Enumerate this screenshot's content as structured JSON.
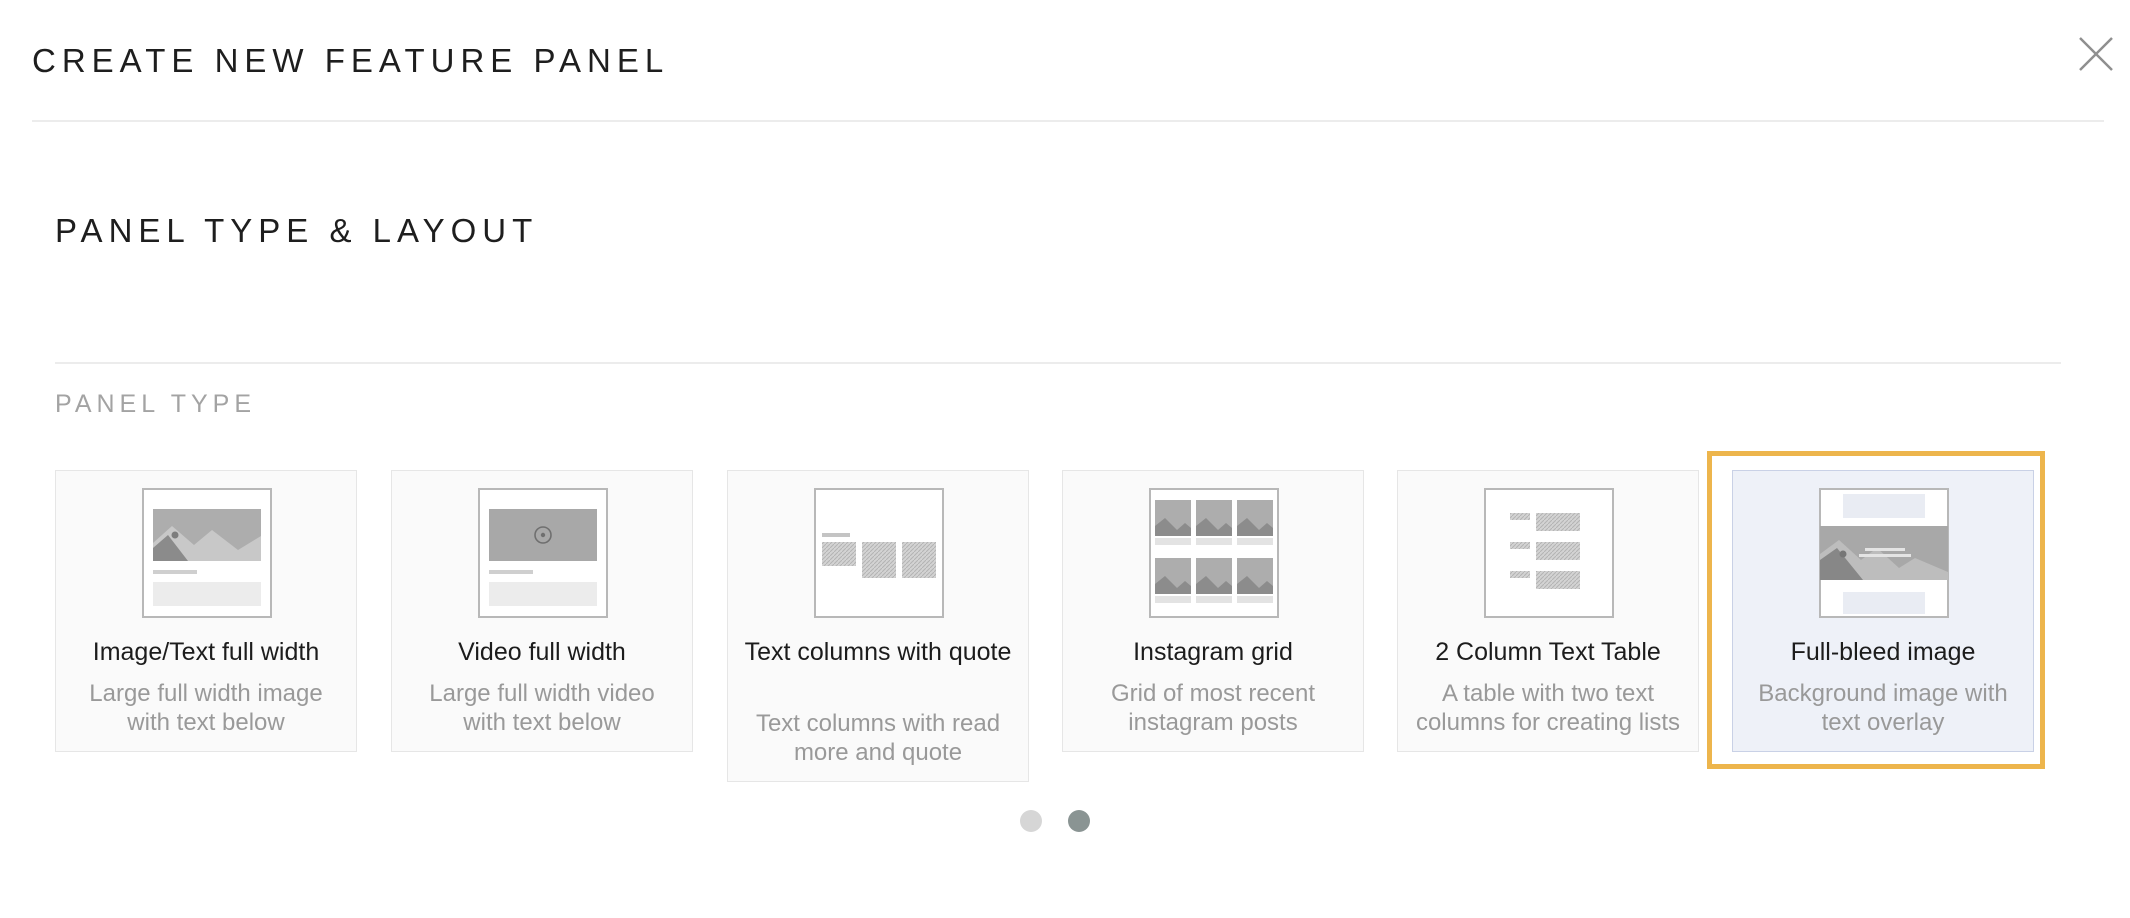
{
  "header": {
    "title": "CREATE NEW FEATURE PANEL"
  },
  "section": {
    "title": "PANEL TYPE & LAYOUT",
    "subheading": "PANEL TYPE"
  },
  "panel_types": [
    {
      "title": "Image/Text full width",
      "description": "Large full width image with text below",
      "icon": "image-text-layout-icon",
      "selected": false
    },
    {
      "title": "Video full width",
      "description": "Large full width video with text below",
      "icon": "video-layout-icon",
      "selected": false
    },
    {
      "title": "Text columns with quote",
      "description": "Text columns with read more and quote",
      "icon": "text-columns-layout-icon",
      "selected": false
    },
    {
      "title": "Instagram grid",
      "description": "Grid of most recent instagram posts",
      "icon": "instagram-grid-layout-icon",
      "selected": false
    },
    {
      "title": "2 Column Text Table",
      "description": "A table with two text columns for creating lists",
      "icon": "two-column-table-layout-icon",
      "selected": false
    },
    {
      "title": "Full-bleed image",
      "description": "Background image with text overlay",
      "icon": "full-bleed-layout-icon",
      "selected": true
    }
  ],
  "pagination": {
    "pages": 2,
    "current": 2
  },
  "colors": {
    "selection_outline": "#edb54c",
    "selected_card_bg": "#eef1f8",
    "dot_inactive": "#d6d6d6",
    "dot_active": "#8a9493"
  }
}
